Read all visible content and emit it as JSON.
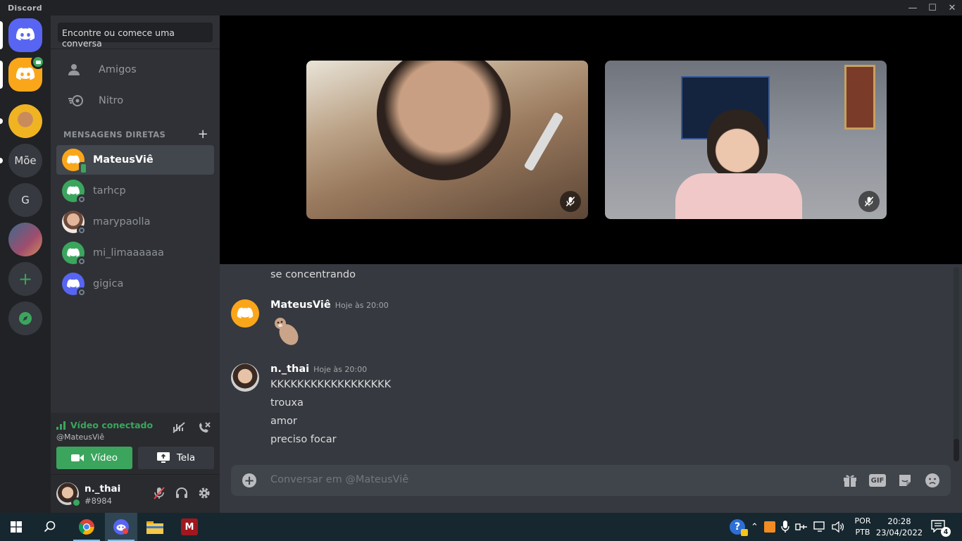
{
  "window": {
    "title": "Discord",
    "controls": [
      "minimize",
      "maximize",
      "close"
    ]
  },
  "guilds": [
    {
      "name": "home",
      "icon": "discord-logo-icon"
    },
    {
      "name": "group-dm",
      "icon": "discord-logo-icon",
      "badge": "video-camera-icon"
    },
    {
      "name": "server-photo-1"
    },
    {
      "name": "server-text",
      "label": "Mõe"
    },
    {
      "name": "server-letter",
      "label": "G"
    },
    {
      "name": "server-photo-2"
    },
    {
      "name": "add-server",
      "icon": "plus-icon"
    },
    {
      "name": "explore",
      "icon": "compass-icon"
    }
  ],
  "search": {
    "placeholder": "Encontre ou comece uma conversa"
  },
  "nav": [
    {
      "label": "Amigos",
      "icon": "friends-icon"
    },
    {
      "label": "Nitro",
      "icon": "nitro-icon"
    }
  ],
  "dm_header": {
    "label": "MENSAGENS DIRETAS",
    "add_icon": "plus-icon"
  },
  "dms": [
    {
      "name": "MateusViê",
      "status": "mobile-online"
    },
    {
      "name": "tarhcp",
      "status": "offline"
    },
    {
      "name": "marypaolla",
      "status": "offline"
    },
    {
      "name": "mi_limaaaaaa",
      "status": "offline"
    },
    {
      "name": "gigica",
      "status": "offline"
    }
  ],
  "voice": {
    "title": "Vídeo conectado",
    "subtitle": "@MateusViê",
    "video_label": "Vídeo",
    "screen_label": "Tela"
  },
  "user": {
    "name": "n._thai",
    "tag": "#8984"
  },
  "messages": {
    "continued": "se concentrando",
    "groups": [
      {
        "author": "MateusViê",
        "time": "Hoje às 20:00",
        "lines": [],
        "sticker": "otter-sticker"
      },
      {
        "author": "n._thai",
        "time": "Hoje às 20:00",
        "lines": [
          "KKKKKKKKKKKKKKKKKK",
          "trouxa",
          "amor",
          "preciso focar"
        ]
      }
    ]
  },
  "composer": {
    "placeholder": "Conversar em @MateusViê",
    "gif_label": "GIF"
  },
  "taskbar": {
    "apps": [
      "windows-start-icon",
      "search-icon",
      "chrome-icon",
      "discord-icon",
      "file-explorer-icon",
      "mendeley-icon"
    ],
    "language": [
      "POR",
      "PTB"
    ],
    "time": "20:28",
    "date": "23/04/2022",
    "notifications": "4"
  },
  "colors": {
    "blurple": "#5865f2",
    "orange": "#faa61a",
    "green": "#3ba55d"
  }
}
